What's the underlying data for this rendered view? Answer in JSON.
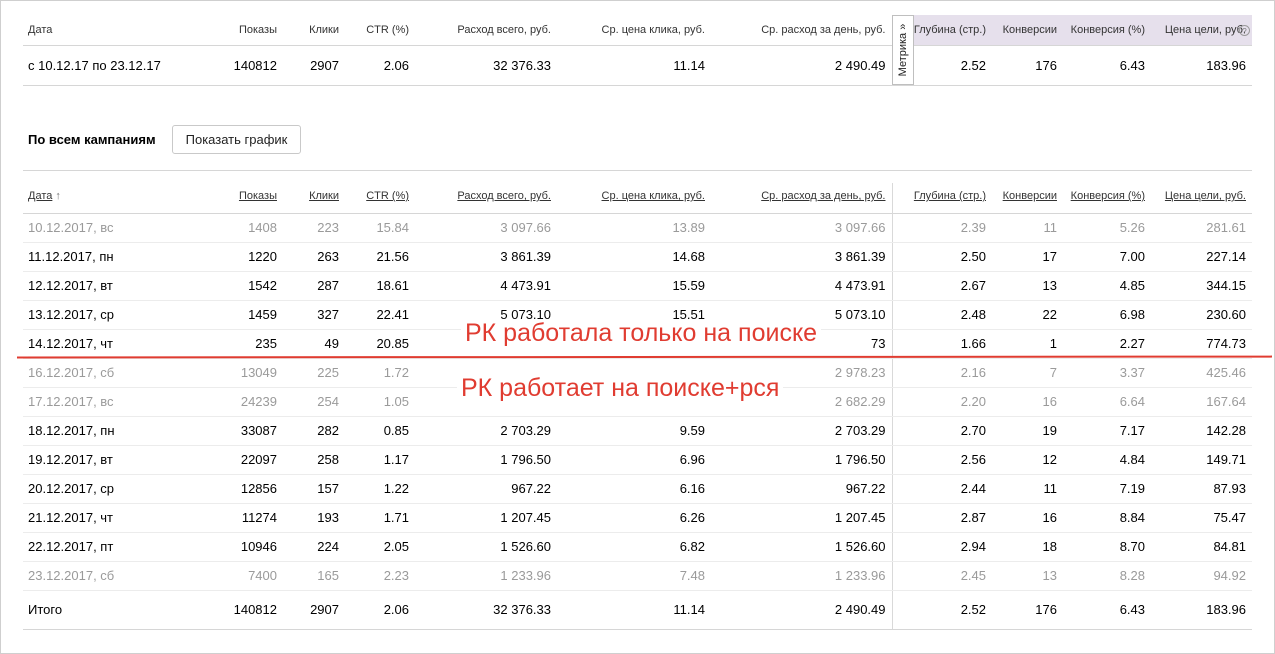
{
  "columns": [
    "Дата",
    "Показы",
    "Клики",
    "CTR (%)",
    "Расход всего, руб.",
    "Ср. цена клика, руб.",
    "Ср. расход за день, руб.",
    "Глубина (стр.)",
    "Конверсии",
    "Конверсия (%)",
    "Цена цели, руб."
  ],
  "summary": [
    "с 10.12.17 по 23.12.17",
    "140812",
    "2907",
    "2.06",
    "32 376.33",
    "11.14",
    "2 490.49",
    "2.52",
    "176",
    "6.43",
    "183.96"
  ],
  "metrika_tab": "Метрика »",
  "section": {
    "label": "По всем кампаниям",
    "chart_button": "Показать график"
  },
  "sort_arrow": "↑",
  "rows": [
    {
      "cells": [
        "10.12.2017, вс",
        "1408",
        "223",
        "15.84",
        "3 097.66",
        "13.89",
        "3 097.66",
        "2.39",
        "11",
        "5.26",
        "281.61"
      ]
    },
    {
      "cells": [
        "11.12.2017, пн",
        "1220",
        "263",
        "21.56",
        "3 861.39",
        "14.68",
        "3 861.39",
        "2.50",
        "17",
        "7.00",
        "227.14"
      ]
    },
    {
      "cells": [
        "12.12.2017, вт",
        "1542",
        "287",
        "18.61",
        "4 473.91",
        "15.59",
        "4 473.91",
        "2.67",
        "13",
        "4.85",
        "344.15"
      ]
    },
    {
      "cells": [
        "13.12.2017, ср",
        "1459",
        "327",
        "22.41",
        "5 073.10",
        "15.51",
        "5 073.10",
        "2.48",
        "22",
        "6.98",
        "230.60"
      ]
    },
    {
      "cells": [
        "14.12.2017, чт",
        "235",
        "49",
        "20.85",
        "",
        "",
        "73",
        "1.66",
        "1",
        "2.27",
        "774.73"
      ]
    },
    {
      "cells": [
        "16.12.2017, сб",
        "13049",
        "225",
        "1.72",
        "",
        "",
        "2 978.23",
        "2.16",
        "7",
        "3.37",
        "425.46"
      ]
    },
    {
      "cells": [
        "17.12.2017, вс",
        "24239",
        "254",
        "1.05",
        "",
        "",
        "2 682.29",
        "2.20",
        "16",
        "6.64",
        "167.64"
      ]
    },
    {
      "cells": [
        "18.12.2017, пн",
        "33087",
        "282",
        "0.85",
        "2 703.29",
        "9.59",
        "2 703.29",
        "2.70",
        "19",
        "7.17",
        "142.28"
      ]
    },
    {
      "cells": [
        "19.12.2017, вт",
        "22097",
        "258",
        "1.17",
        "1 796.50",
        "6.96",
        "1 796.50",
        "2.56",
        "12",
        "4.84",
        "149.71"
      ]
    },
    {
      "cells": [
        "20.12.2017, ср",
        "12856",
        "157",
        "1.22",
        "967.22",
        "6.16",
        "967.22",
        "2.44",
        "11",
        "7.19",
        "87.93"
      ]
    },
    {
      "cells": [
        "21.12.2017, чт",
        "11274",
        "193",
        "1.71",
        "1 207.45",
        "6.26",
        "1 207.45",
        "2.87",
        "16",
        "8.84",
        "75.47"
      ]
    },
    {
      "cells": [
        "22.12.2017, пт",
        "10946",
        "224",
        "2.05",
        "1 526.60",
        "6.82",
        "1 526.60",
        "2.94",
        "18",
        "8.70",
        "84.81"
      ]
    },
    {
      "cells": [
        "23.12.2017, сб",
        "7400",
        "165",
        "2.23",
        "1 233.96",
        "7.48",
        "1 233.96",
        "2.45",
        "13",
        "8.28",
        "94.92"
      ]
    }
  ],
  "total": [
    "Итого",
    "140812",
    "2907",
    "2.06",
    "32 376.33",
    "11.14",
    "2 490.49",
    "2.52",
    "176",
    "6.43",
    "183.96"
  ],
  "annotations": {
    "top": "РК работала только на поиске",
    "bottom": "РК работает на поиске+рся"
  },
  "colors": {
    "annotation": "#e03c31",
    "metrika_header_bg": "#e6e0ec",
    "dim_text": "#9a9a9a"
  }
}
